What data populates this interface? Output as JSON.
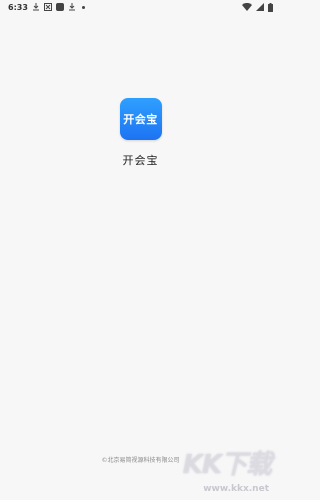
{
  "status_bar": {
    "time": "6:33",
    "notification_icons": [
      "download-icon",
      "x-box-icon",
      "square-icon",
      "download-icon",
      "dot-icon"
    ],
    "system_icons": [
      "wifi-icon",
      "signal-icon",
      "battery-icon"
    ]
  },
  "splash": {
    "icon_text": "开会宝",
    "app_name": "开会宝"
  },
  "footer": {
    "copyright": "©北京易简视源科技有限公司"
  },
  "watermark": {
    "main": "KK下载",
    "sub": "www.kkx.net"
  }
}
